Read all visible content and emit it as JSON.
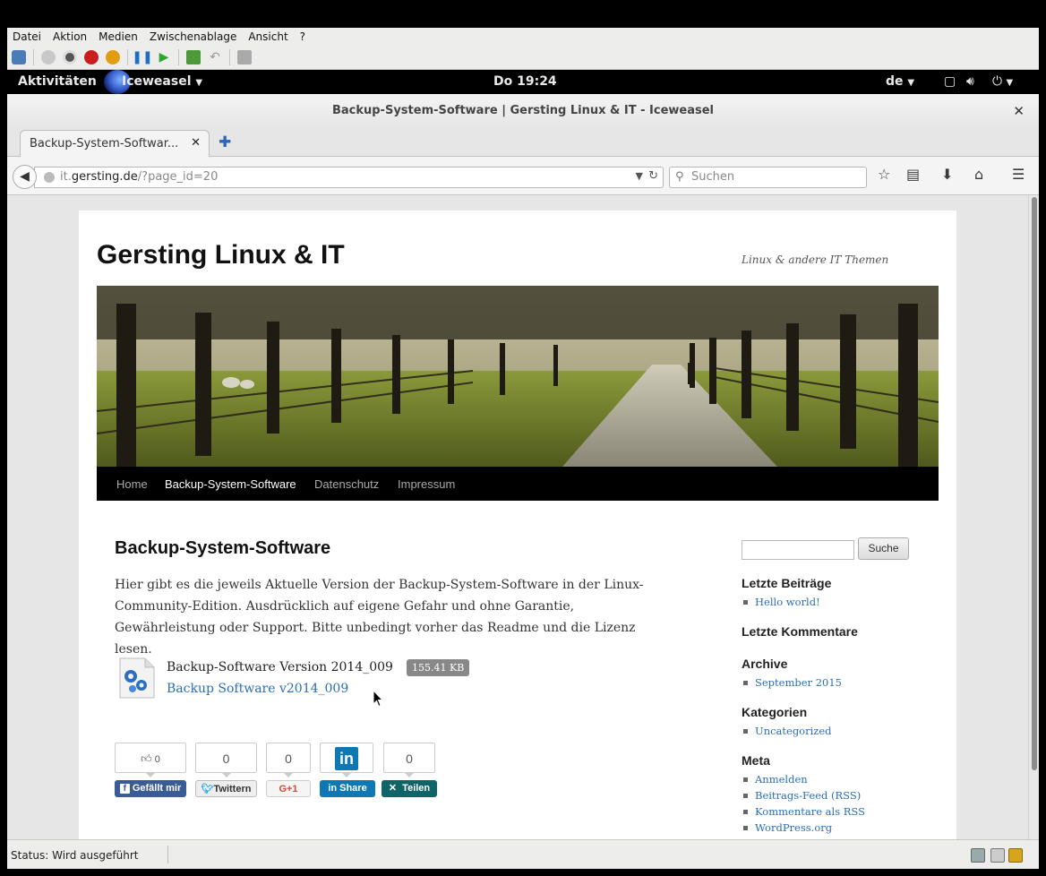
{
  "vm": {
    "menu": [
      "Datei",
      "Aktion",
      "Medien",
      "Zwischenablage",
      "Ansicht",
      "?"
    ]
  },
  "gnome": {
    "activities": "Aktivitäten",
    "app_name": "Iceweasel",
    "clock": "Do 19:24",
    "language": "de"
  },
  "browser": {
    "window_title": "Backup-System-Software | Gersting Linux & IT - Iceweasel",
    "tab_label": "Backup-System-Softwar...",
    "url_prefix": "it.",
    "url_host": "gersting.de",
    "url_path": "/?page_id=20",
    "search_placeholder": "Suchen",
    "status": "Status: Wird ausgeführt"
  },
  "site": {
    "title": "Gersting Linux & IT",
    "tagline": "Linux & andere IT Themen",
    "nav": [
      "Home",
      "Backup-System-Software",
      "Datenschutz",
      "Impressum"
    ],
    "nav_active": 1
  },
  "entry": {
    "title": "Backup-System-Software",
    "body": "Hier gibt es die jeweils Aktuelle Version der Backup-System-Software in der Linux-Community-Edition. Ausdrücklich auf eigene Gefahr und ohne Garantie, Gewährleistung oder Support. Bitte unbedingt vorher das Readme und die Lizenz lesen.",
    "download_name": "Backup-Software Version 2014_009",
    "download_size": "155.41 KB",
    "download_link": "Backup Software v2014_009"
  },
  "share": {
    "facebook_count": "0",
    "facebook_label": "Gefällt mir",
    "twitter_count": "0",
    "twitter_label": "Twittern",
    "gplus_count": "0",
    "gplus_label": "G+1",
    "linkedin_label": "Share",
    "xing_count": "0",
    "xing_label": "Teilen"
  },
  "sidebar": {
    "search_button": "Suche",
    "recent_posts_title": "Letzte Beiträge",
    "recent_posts": [
      "Hello world!"
    ],
    "recent_comments_title": "Letzte Kommentare",
    "archive_title": "Archive",
    "archive": [
      "September 2015"
    ],
    "categories_title": "Kategorien",
    "categories": [
      "Uncategorized"
    ],
    "meta_title": "Meta",
    "meta": [
      "Anmelden",
      "Beitrags-Feed (RSS)",
      "Kommentare als RSS",
      "WordPress.org"
    ]
  },
  "colors": {
    "link": "#2a6eb2",
    "facebook": "#3b5a98",
    "linkedin": "#0e77b5",
    "xing": "#0f6467",
    "gplus_text": "#d34836"
  }
}
